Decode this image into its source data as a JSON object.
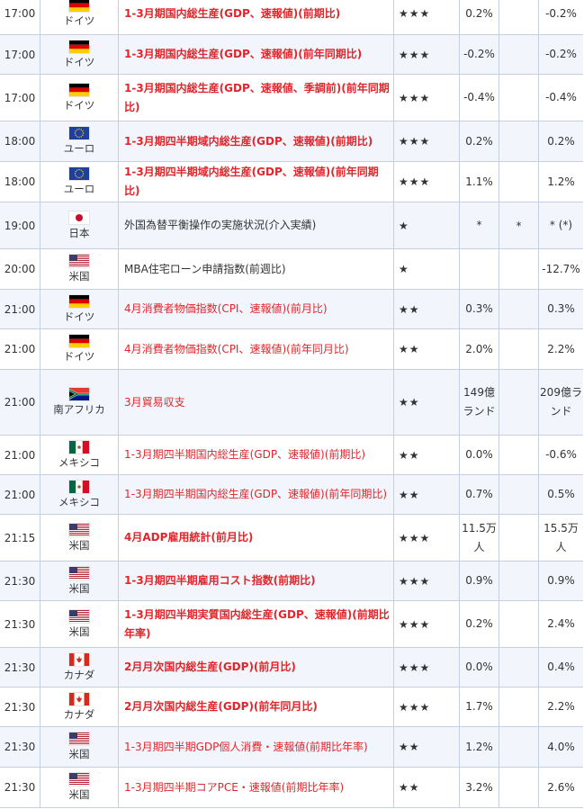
{
  "table": {
    "rows": [
      {
        "time": "17:00",
        "country": "ドイツ",
        "flag": "germany-flag-icon",
        "indicator": "1-3月期国内総生産(GDP、速報値)(前期比)",
        "importance": "★★★",
        "level": "hi",
        "previous": "0.2%",
        "forecast": "",
        "result": "-0.2%"
      },
      {
        "time": "17:00",
        "country": "ドイツ",
        "flag": "germany-flag-icon",
        "indicator": "1-3月期国内総生産(GDP、速報値)(前年同期比)",
        "importance": "★★★",
        "level": "hi",
        "previous": "-0.2%",
        "forecast": "",
        "result": "-0.2%"
      },
      {
        "time": "17:00",
        "country": "ドイツ",
        "flag": "germany-flag-icon",
        "indicator": "1-3月期国内総生産(GDP、速報値、季調前)(前年同期比)",
        "importance": "★★★",
        "level": "hi",
        "previous": "-0.4%",
        "forecast": "",
        "result": "-0.4%"
      },
      {
        "time": "18:00",
        "country": "ユーロ",
        "flag": "eu-flag-icon",
        "indicator": "1-3月期四半期域内総生産(GDP、速報値)(前期比)",
        "importance": "★★★",
        "level": "hi",
        "previous": "0.2%",
        "forecast": "",
        "result": "0.2%"
      },
      {
        "time": "18:00",
        "country": "ユーロ",
        "flag": "eu-flag-icon",
        "indicator": "1-3月期四半期域内総生産(GDP、速報値)(前年同期比)",
        "importance": "★★★",
        "level": "hi",
        "previous": "1.1%",
        "forecast": "",
        "result": "1.2%"
      },
      {
        "time": "19:00",
        "country": "日本",
        "flag": "japan-flag-icon",
        "indicator": "外国為替平衡操作の実施状況(介入実績)",
        "importance": "★",
        "level": "lo",
        "previous": "*",
        "forecast": "*",
        "result": "* (*)"
      },
      {
        "time": "20:00",
        "country": "米国",
        "flag": "usa-flag-icon",
        "indicator": "MBA住宅ローン申請指数(前週比)",
        "importance": "★",
        "level": "lo",
        "previous": "",
        "forecast": "",
        "result": "-12.7%"
      },
      {
        "time": "21:00",
        "country": "ドイツ",
        "flag": "germany-flag-icon",
        "indicator": "4月消費者物価指数(CPI、速報値)(前月比)",
        "importance": "★★",
        "level": "mid",
        "previous": "0.3%",
        "forecast": "",
        "result": "0.3%"
      },
      {
        "time": "21:00",
        "country": "ドイツ",
        "flag": "germany-flag-icon",
        "indicator": "4月消費者物価指数(CPI、速報値)(前年同月比)",
        "importance": "★★",
        "level": "mid",
        "previous": "2.0%",
        "forecast": "",
        "result": "2.2%"
      },
      {
        "time": "21:00",
        "country": "南アフリカ",
        "flag": "south-africa-flag-icon",
        "indicator": "3月貿易収支",
        "importance": "★★",
        "level": "mid",
        "previous": "149億ランド",
        "forecast": "",
        "result": "209億ランド"
      },
      {
        "time": "21:00",
        "country": "メキシコ",
        "flag": "mexico-flag-icon",
        "indicator": "1-3月期四半期国内総生産(GDP、速報値)(前期比)",
        "importance": "★★",
        "level": "mid",
        "previous": "0.0%",
        "forecast": "",
        "result": "-0.6%"
      },
      {
        "time": "21:00",
        "country": "メキシコ",
        "flag": "mexico-flag-icon",
        "indicator": "1-3月期四半期国内総生産(GDP、速報値)(前年同期比)",
        "importance": "★★",
        "level": "mid",
        "previous": "0.7%",
        "forecast": "",
        "result": "0.5%"
      },
      {
        "time": "21:15",
        "country": "米国",
        "flag": "usa-flag-icon",
        "indicator": "4月ADP雇用統計(前月比)",
        "importance": "★★★",
        "level": "hi",
        "previous": "11.5万人",
        "forecast": "",
        "result": "15.5万人"
      },
      {
        "time": "21:30",
        "country": "米国",
        "flag": "usa-flag-icon",
        "indicator": "1-3月期四半期雇用コスト指数(前期比)",
        "importance": "★★★",
        "level": "hi",
        "previous": "0.9%",
        "forecast": "",
        "result": "0.9%"
      },
      {
        "time": "21:30",
        "country": "米国",
        "flag": "usa-flag-icon",
        "indicator": "1-3月期四半期実質国内総生産(GDP、速報値)(前期比年率)",
        "importance": "★★★",
        "level": "hi",
        "previous": "0.2%",
        "forecast": "",
        "result": "2.4%"
      },
      {
        "time": "21:30",
        "country": "カナダ",
        "flag": "canada-flag-icon",
        "indicator": "2月月次国内総生産(GDP)(前月比)",
        "importance": "★★★",
        "level": "hi",
        "previous": "0.0%",
        "forecast": "",
        "result": "0.4%"
      },
      {
        "time": "21:30",
        "country": "カナダ",
        "flag": "canada-flag-icon",
        "indicator": "2月月次国内総生産(GDP)(前年同月比)",
        "importance": "★★★",
        "level": "hi",
        "previous": "1.7%",
        "forecast": "",
        "result": "2.2%"
      },
      {
        "time": "21:30",
        "country": "米国",
        "flag": "usa-flag-icon",
        "indicator": "1-3月期四半期GDP個人消費・速報値(前期比年率)",
        "importance": "★★",
        "level": "mid",
        "previous": "1.2%",
        "forecast": "",
        "result": "4.0%"
      },
      {
        "time": "21:30",
        "country": "米国",
        "flag": "usa-flag-icon",
        "indicator": "1-3月期四半期コアPCE・速報値(前期比年率)",
        "importance": "★★",
        "level": "mid",
        "previous": "3.2%",
        "forecast": "",
        "result": "2.6%"
      }
    ]
  }
}
